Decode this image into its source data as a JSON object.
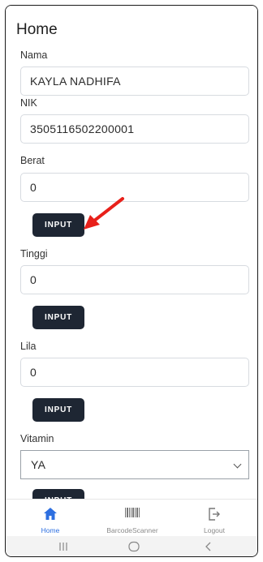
{
  "header": {
    "title": "Home"
  },
  "form": {
    "nama": {
      "label": "Nama",
      "value": "KAYLA NADHIFA"
    },
    "nik": {
      "label": "NIK",
      "value": "3505116502200001"
    },
    "berat": {
      "label": "Berat",
      "value": "0",
      "button": "INPUT"
    },
    "tinggi": {
      "label": "Tinggi",
      "value": "0",
      "button": "INPUT"
    },
    "lila": {
      "label": "Lila",
      "value": "0",
      "button": "INPUT"
    },
    "vitamin": {
      "label": "Vitamin",
      "value": "YA",
      "button": "INPUT"
    }
  },
  "tabs": [
    {
      "label": "Home",
      "icon": "home-icon",
      "active": true
    },
    {
      "label": "BarcodeScanner",
      "icon": "barcode-icon",
      "active": false
    },
    {
      "label": "Logout",
      "icon": "logout-icon",
      "active": false
    }
  ],
  "colors": {
    "button_bg": "#1e2633",
    "active_tab": "#2d6fe0",
    "annotation_arrow": "#e8201a"
  },
  "system_nav": {
    "recents": "recents-icon",
    "home": "home-circle-icon",
    "back": "back-icon"
  }
}
